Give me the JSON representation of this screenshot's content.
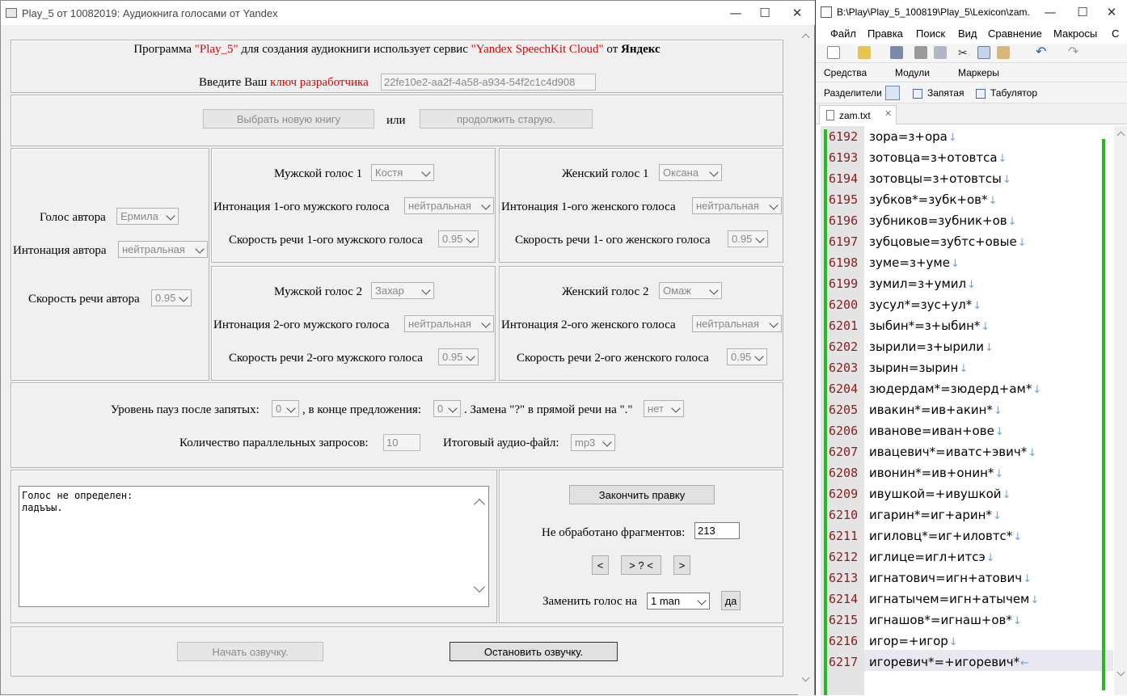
{
  "left_window": {
    "title": "Play_5 от 10082019: Аудиокнига голосами от Yandex",
    "intro": {
      "part1": "Программа ",
      "program": "\"Play_5\"",
      "part2": " для создания аудиокниги использует сервис ",
      "service": "\"Yandex SpeechKit Cloud\"",
      "part3": " от ",
      "vendor": "Яндекс"
    },
    "key": {
      "label": "Введите Ваш ",
      "label_red": "ключ разработчика",
      "value": "22fe10e2-aa2f-4a58-a934-54f2c1c4d908"
    },
    "book": {
      "choose_new": "Выбрать новую книгу",
      "or": "или",
      "continue_old": "продолжить  старую."
    },
    "author": {
      "voice_label": "Голос автора",
      "voice_value": "Ермила",
      "intonation_label": "Интонация автора",
      "intonation_value": "нейтральная",
      "speed_label": "Скорость речи автора",
      "speed_value": "0.95"
    },
    "male1": {
      "voice_label": "Мужской голос 1",
      "voice_value": "Костя",
      "intonation_label": "Интонация 1-ого мужского голоса",
      "intonation_value": "нейтральная",
      "speed_label": "Скорость речи 1-ого мужского голоса",
      "speed_value": "0.95"
    },
    "female1": {
      "voice_label": "Женский голос 1",
      "voice_value": "Оксана",
      "intonation_label": "Интонация 1-ого женского голоса",
      "intonation_value": "нейтральная",
      "speed_label": "Скорость речи 1- ого женского голоса",
      "speed_value": "0.95"
    },
    "male2": {
      "voice_label": "Мужской голос 2",
      "voice_value": "Захар",
      "intonation_label": "Интонация 2-ого мужского голоса",
      "intonation_value": "нейтральная",
      "speed_label": "Скорость речи 2-ого мужского голоса",
      "speed_value": "0.95"
    },
    "female2": {
      "voice_label": "Женский голос 2",
      "voice_value": "Омаж",
      "intonation_label": "Интонация 2-ого женского голоса",
      "intonation_value": "нейтральная",
      "speed_label": "Скорость речи 2-ого женского голоса",
      "speed_value": "0.95"
    },
    "pauses": {
      "comma_label": "Уровень пауз после запятых:",
      "comma_value": "0",
      "sentence_label": ", в конце предложения:",
      "sentence_value": "0",
      "replace_label": ". Замена \"?\" в прямой речи на \".\"",
      "replace_value": "нет",
      "parallel_label": "Количество параллельных запросов:",
      "parallel_value": "10",
      "output_label": "Итоговый аудио-файл:",
      "output_value": "mp3"
    },
    "message": "Голос не определен:\nладъъы.",
    "editing": {
      "finish_label": "Закончить правку",
      "unprocessed_label": "Не обработано фрагментов:",
      "unprocessed_value": "213",
      "prev": "<",
      "middle": "> ? <",
      "next": ">",
      "replace_label": "Заменить голос на",
      "replace_value": "1 man",
      "yes": "да"
    },
    "footer": {
      "start": "Начать озвучку.",
      "stop": "Остановить озвучку."
    }
  },
  "right_window": {
    "title": "B:\\Play\\Play_5_100819\\Play_5\\Lexicon\\zam...",
    "menu": [
      "Файл",
      "Правка",
      "Поиск",
      "Вид",
      "Сравнение",
      "Макросы",
      "С"
    ],
    "toolbar2": [
      "Средства",
      "Модули",
      "Маркеры"
    ],
    "toolbar3": [
      "Разделители",
      "Запятая",
      "Табулятор"
    ],
    "tab": "zam.txt",
    "lines": [
      {
        "n": "6192",
        "t": "зора=з+ора"
      },
      {
        "n": "6193",
        "t": "зотовца=з+отовтса"
      },
      {
        "n": "6194",
        "t": "зотовцы=з+отовтсы"
      },
      {
        "n": "6195",
        "t": "зубков*=зубк+ов*"
      },
      {
        "n": "6196",
        "t": "зубников=зубник+ов"
      },
      {
        "n": "6197",
        "t": "зубцовые=зубтс+овые"
      },
      {
        "n": "6198",
        "t": "зуме=з+уме"
      },
      {
        "n": "6199",
        "t": "зумил=з+умил"
      },
      {
        "n": "6200",
        "t": "зусул*=зус+ул*"
      },
      {
        "n": "6201",
        "t": "зыбин*=з+ыбин*"
      },
      {
        "n": "6202",
        "t": "зырили=з+ырили"
      },
      {
        "n": "6203",
        "t": "зырин=зырин"
      },
      {
        "n": "6204",
        "t": "зюдердам*=зюдерд+ам*"
      },
      {
        "n": "6205",
        "t": "ивакин*=ив+акин*"
      },
      {
        "n": "6206",
        "t": "иванове=иван+ове"
      },
      {
        "n": "6207",
        "t": "ивацевич*=иватс+эвич*"
      },
      {
        "n": "6208",
        "t": "ивонин*=ив+онин*"
      },
      {
        "n": "6209",
        "t": "ивушкой=+ивушкой"
      },
      {
        "n": "6210",
        "t": "игарин*=иг+арин*"
      },
      {
        "n": "6211",
        "t": "игиловц*=иг+иловтс*"
      },
      {
        "n": "6212",
        "t": "иглице=игл+итсэ"
      },
      {
        "n": "6213",
        "t": "игнатович=игн+атович"
      },
      {
        "n": "6214",
        "t": "игнатычем=игн+атычем"
      },
      {
        "n": "6215",
        "t": "игнашов*=игнаш+ов*"
      },
      {
        "n": "6216",
        "t": "игор=+игор"
      },
      {
        "n": "6217",
        "t": "игоревич*=+игоревич*"
      }
    ]
  }
}
